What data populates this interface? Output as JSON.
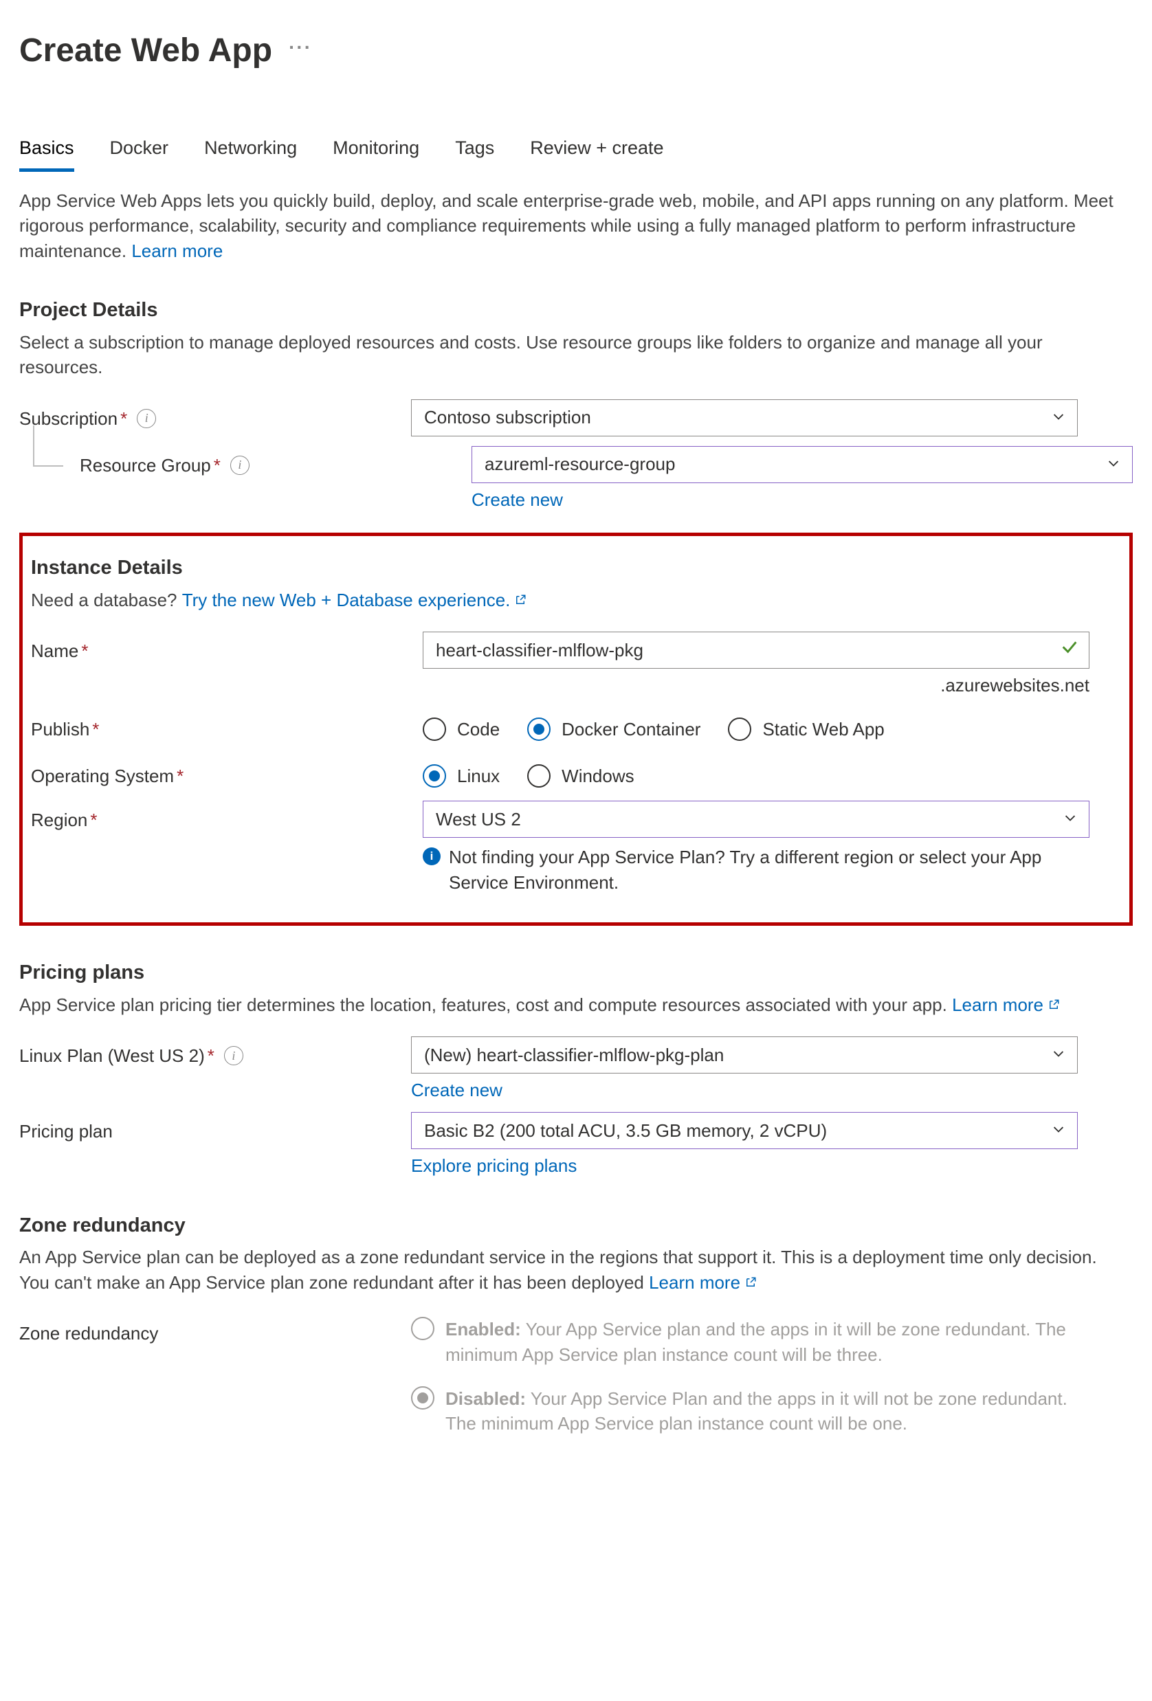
{
  "header": {
    "title": "Create Web App"
  },
  "tabs": [
    "Basics",
    "Docker",
    "Networking",
    "Monitoring",
    "Tags",
    "Review + create"
  ],
  "active_tab_index": 0,
  "intro": {
    "text": "App Service Web Apps lets you quickly build, deploy, and scale enterprise-grade web, mobile, and API apps running on any platform. Meet rigorous performance, scalability, security and compliance requirements while using a fully managed platform to perform infrastructure maintenance.  ",
    "learn_more": "Learn more"
  },
  "project_details": {
    "heading": "Project Details",
    "desc": "Select a subscription to manage deployed resources and costs. Use resource groups like folders to organize and manage all your resources.",
    "subscription_label": "Subscription",
    "subscription_value": "Contoso subscription",
    "rg_label": "Resource Group",
    "rg_value": "azureml-resource-group",
    "create_new": "Create new"
  },
  "instance_details": {
    "heading": "Instance Details",
    "db_prompt": "Need a database? ",
    "db_link": "Try the new Web + Database experience.",
    "name_label": "Name",
    "name_value": "heart-classifier-mlflow-pkg",
    "domain_suffix": ".azurewebsites.net",
    "publish_label": "Publish",
    "publish_options": [
      "Code",
      "Docker Container",
      "Static Web App"
    ],
    "publish_selected_index": 1,
    "os_label": "Operating System",
    "os_options": [
      "Linux",
      "Windows"
    ],
    "os_selected_index": 0,
    "region_label": "Region",
    "region_value": "West US 2",
    "region_info": "Not finding your App Service Plan? Try a different region or select your App Service Environment."
  },
  "pricing": {
    "heading": "Pricing plans",
    "desc": "App Service plan pricing tier determines the location, features, cost and compute resources associated with your app. ",
    "learn_more": "Learn more",
    "plan_label": "Linux Plan (West US 2)",
    "plan_value": "(New) heart-classifier-mlflow-pkg-plan",
    "create_new": "Create new",
    "tier_label": "Pricing plan",
    "tier_value": "Basic B2 (200 total ACU, 3.5 GB memory, 2 vCPU)",
    "explore": "Explore pricing plans"
  },
  "zone": {
    "heading": "Zone redundancy",
    "desc": "An App Service plan can be deployed as a zone redundant service in the regions that support it. This is a deployment time only decision. You can't make an App Service plan zone redundant after it has been deployed ",
    "learn_more": "Learn more",
    "label": "Zone redundancy",
    "options": [
      {
        "title": "Enabled:",
        "desc": " Your App Service plan and the apps in it will be zone redundant. The minimum App Service plan instance count will be three."
      },
      {
        "title": "Disabled:",
        "desc": " Your App Service Plan and the apps in it will not be zone redundant. The minimum App Service plan instance count will be one."
      }
    ],
    "selected_index": 1
  }
}
